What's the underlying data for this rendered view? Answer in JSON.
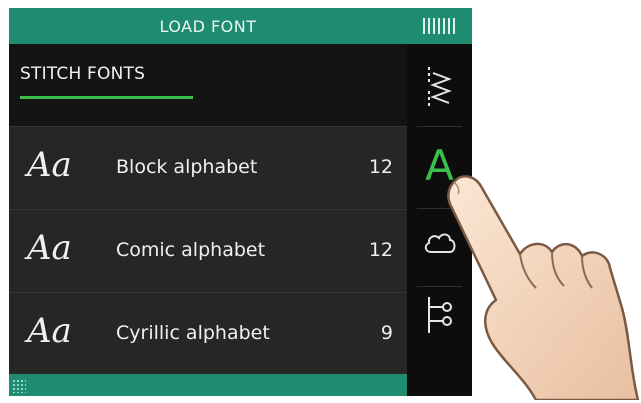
{
  "header": {
    "title": "LOAD FONT"
  },
  "section": {
    "title": "STITCH FONTS"
  },
  "fonts": [
    {
      "sample": "Aa",
      "name": "Block alphabet",
      "count": "12"
    },
    {
      "sample": "Aa",
      "name": "Comic alphabet",
      "count": "12"
    },
    {
      "sample": "Aa",
      "name": "Cyrillic alphabet",
      "count": "9"
    }
  ],
  "rail": {
    "items": [
      {
        "icon": "stitch-zigzag-icon"
      },
      {
        "icon": "font-A-icon",
        "letter": "A",
        "active": true
      },
      {
        "icon": "cloud-icon"
      },
      {
        "icon": "settings-sliders-icon"
      }
    ]
  },
  "colors": {
    "accent": "#1f8c72",
    "active": "#3bbf4a",
    "panel": "#141414",
    "row": "#262626"
  }
}
